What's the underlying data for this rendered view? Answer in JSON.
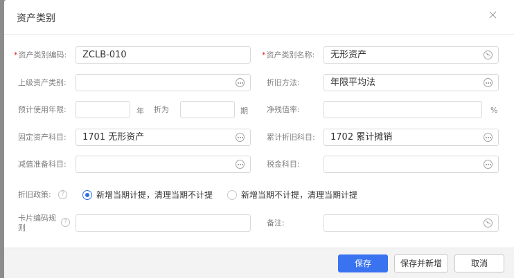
{
  "dialog": {
    "title": "资产类别"
  },
  "form": {
    "code_label": "资产类别编码:",
    "code_value": "ZCLB-010",
    "name_label": "资产类别名称:",
    "name_value": "无形资产",
    "parent_label": "上级资产类别:",
    "parent_value": "",
    "depmethod_label": "折旧方法:",
    "depmethod_value": "年限平均法",
    "life_label": "预计使用年限:",
    "life_value": "",
    "life_unit": "年",
    "zhewei_label": "折为",
    "zhewei_value": "",
    "period_unit": "期",
    "salvage_label": "净残值率:",
    "salvage_value": "",
    "percent_unit": "%",
    "fixed_label": "固定资产科目:",
    "fixed_value": "1701 无形资产",
    "accum_label": "累计折旧科目:",
    "accum_value": "1702 累计摊销",
    "impair_label": "减值准备科目:",
    "impair_value": "",
    "tax_label": "税金科目:",
    "tax_value": "",
    "policy_label": "折旧政策:",
    "policy_option1": "新增当期计提，清理当期不计提",
    "policy_option2": "新增当期不计提，清理当期计提",
    "card_rule_line1": "卡片编码规",
    "card_rule_line2": "则",
    "card_rule_value": "",
    "remark_label": "备注:",
    "remark_value": ""
  },
  "footer": {
    "save": "保存",
    "save_new": "保存并新增",
    "cancel": "取消"
  }
}
